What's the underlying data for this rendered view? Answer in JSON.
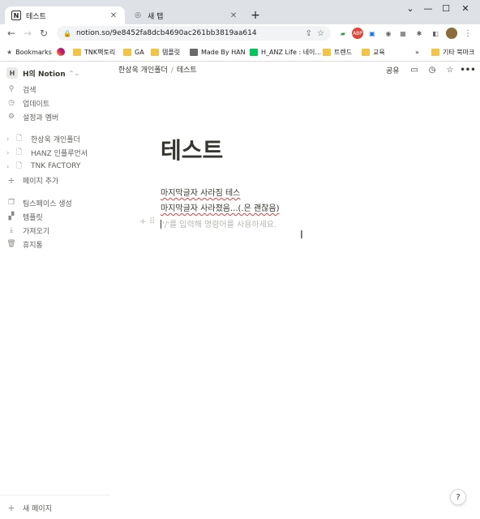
{
  "browser": {
    "tabs": [
      {
        "title": "테스트",
        "favicon": "N"
      },
      {
        "title": "새 탭",
        "favicon": "◎"
      }
    ],
    "url": "notion.so/9e8452fa8dcb4690ac261bb3819aa614",
    "bookmarks": [
      {
        "label": "Bookmarks",
        "icon": "star-icon"
      },
      {
        "label": "",
        "icon": "instagram-icon"
      },
      {
        "label": "TNK팩토리",
        "icon": "folder-icon"
      },
      {
        "label": "GA",
        "icon": "folder-icon"
      },
      {
        "label": "템플릿",
        "icon": "folder-icon"
      },
      {
        "label": "Made By HAN",
        "icon": "image-icon"
      },
      {
        "label": "H_ANZ Life : 네이...",
        "icon": "naver-icon"
      },
      {
        "label": "트렌드",
        "icon": "folder-icon"
      },
      {
        "label": "교육",
        "icon": "folder-icon"
      },
      {
        "label": "»",
        "icon": "more-icon"
      },
      {
        "label": "기타 북마크",
        "icon": "folder-icon"
      }
    ]
  },
  "sidebar": {
    "workspace": {
      "icon_letter": "H",
      "name": "H의 Notion"
    },
    "nav": [
      {
        "label": "검색",
        "icon": "search-icon"
      },
      {
        "label": "업데이트",
        "icon": "clock-icon"
      },
      {
        "label": "설정과 멤버",
        "icon": "gear-icon"
      }
    ],
    "pages": [
      {
        "label": "한상욱 개인폴더"
      },
      {
        "label": "HANZ 인플루언서"
      },
      {
        "label": "TNK FACTORY"
      }
    ],
    "add_page": "페이지 추가",
    "tools": [
      {
        "label": "팀스페이스 생성",
        "icon": "teamspace-icon"
      },
      {
        "label": "템플릿",
        "icon": "template-icon"
      },
      {
        "label": "가져오기",
        "icon": "import-icon"
      },
      {
        "label": "휴지통",
        "icon": "trash-icon"
      }
    ],
    "new_page": "새 페이지"
  },
  "topbar": {
    "breadcrumb": [
      "한상욱 개인폴더",
      "테스트"
    ],
    "share": "공유"
  },
  "page": {
    "title": "테스트",
    "lines": [
      "마지막글자 사라짐 테스",
      "마지막글자 사라졌음...(.은 괜찮음)"
    ],
    "placeholder": "'/'를 입력해 명령어를 사용하세요."
  },
  "help": "?"
}
